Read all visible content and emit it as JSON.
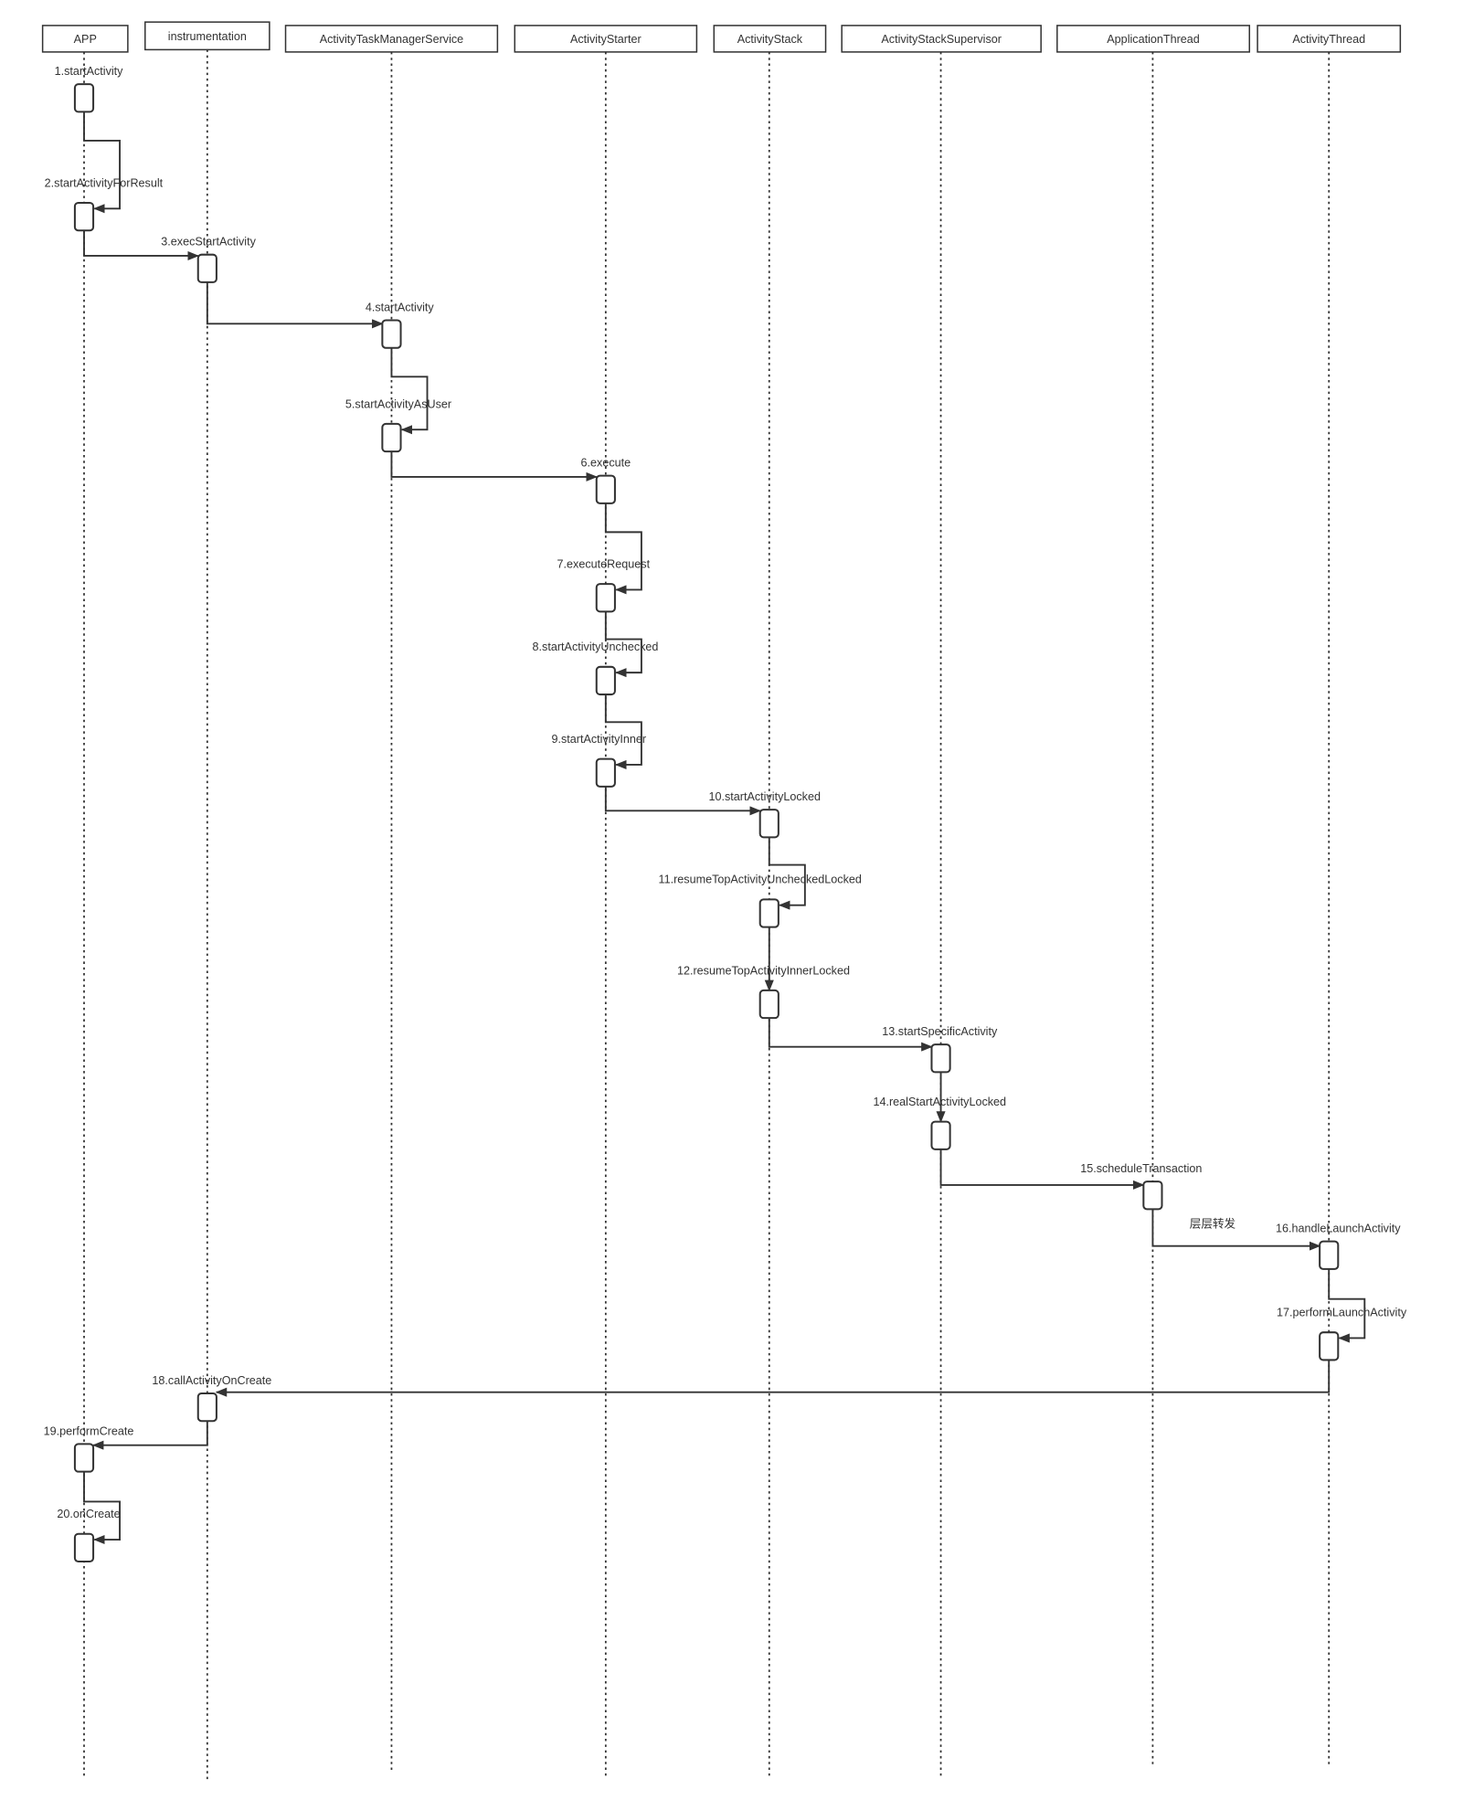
{
  "participants": [
    "APP",
    "instrumentation",
    "ActivityTaskManagerService",
    "ActivityStarter",
    "ActivityStack",
    "ActivityStackSupervisor",
    "ApplicationThread",
    "ActivityThread"
  ],
  "messages": [
    "1.startActivity",
    "2.startActivityForResult",
    "3.execStartActivity",
    "4.startActivity",
    "5.startActivityAsUser",
    "6.execute",
    "7.executeRequest",
    "8.startActivityUnchecked",
    "9.startActivityInner",
    "10.startActivityLocked",
    "11.resumeTopActivityUncheckedLocked",
    "12.resumeTopActivityInnerLocked",
    "13.startSpecificActivity",
    "14.realStartActivityLocked",
    "15.scheduleTransaction",
    "16.handleLaunchActivity",
    "17.performLaunchActivity",
    "18.callActivityOnCreate",
    "19.performCreate",
    "20.onCreate"
  ],
  "note": "层层转发",
  "colors": {
    "line": "#333333",
    "background": "#ffffff"
  }
}
